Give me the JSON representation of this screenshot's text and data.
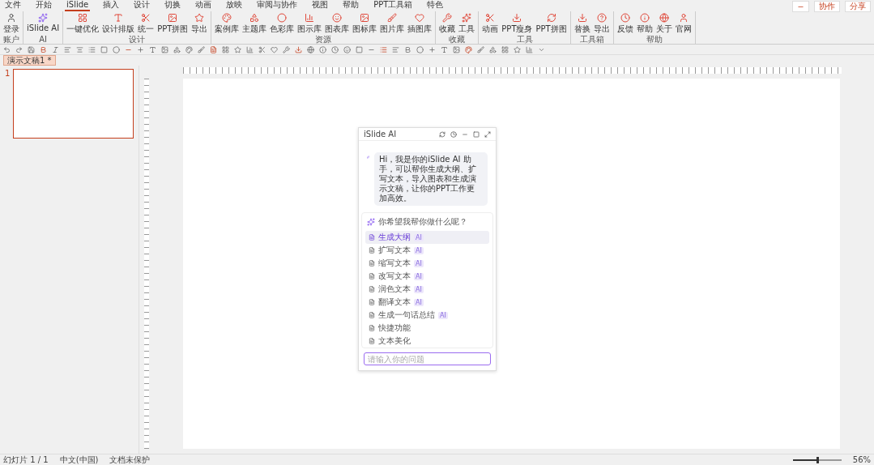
{
  "menu": [
    {
      "label": "文件",
      "selected": false
    },
    {
      "label": "开始",
      "selected": false
    },
    {
      "label": "iSlide",
      "selected": true
    },
    {
      "label": "插入",
      "selected": false
    },
    {
      "label": "设计",
      "selected": false
    },
    {
      "label": "切换",
      "selected": false
    },
    {
      "label": "动画",
      "selected": false
    },
    {
      "label": "放映",
      "selected": false
    },
    {
      "label": "审阅与协作",
      "selected": false
    },
    {
      "label": "视图",
      "selected": false
    },
    {
      "label": "帮助",
      "selected": false
    },
    {
      "label": "PPT工具箱",
      "selected": false
    },
    {
      "label": "特色",
      "selected": false
    }
  ],
  "top_buttons": [
    {
      "label": "协作"
    },
    {
      "label": "分享"
    }
  ],
  "ribbon": [
    {
      "label": "账户",
      "items": [
        {
          "label": "登录"
        }
      ]
    },
    {
      "label": "AI",
      "items": [
        {
          "label": "iSlide AI"
        }
      ]
    },
    {
      "label": "设计",
      "items": [
        {
          "label": "一键优化"
        },
        {
          "label": "设计排版"
        },
        {
          "label": "统一"
        },
        {
          "label": "PPT拼图"
        },
        {
          "label": "导出"
        }
      ]
    },
    {
      "label": "资源",
      "items": [
        {
          "label": "案例库"
        },
        {
          "label": "主题库"
        },
        {
          "label": "色彩库"
        },
        {
          "label": "图示库"
        },
        {
          "label": "图表库"
        },
        {
          "label": "图标库"
        },
        {
          "label": "图片库"
        },
        {
          "label": "插图库"
        }
      ]
    },
    {
      "label": "收藏",
      "items": [
        {
          "label": "收藏"
        },
        {
          "label": "工具"
        }
      ]
    },
    {
      "label": "工具",
      "items": [
        {
          "label": "动画"
        },
        {
          "label": "PPT瘦身"
        },
        {
          "label": "PPT拼图"
        }
      ]
    },
    {
      "label": "工具箱",
      "items": [
        {
          "label": "替换"
        },
        {
          "label": "导出"
        }
      ]
    },
    {
      "label": "帮助",
      "items": [
        {
          "label": "反馈"
        },
        {
          "label": "帮助"
        },
        {
          "label": "关于"
        },
        {
          "label": "官网"
        }
      ]
    }
  ],
  "doc_tab": {
    "label": "演示文稿1 *"
  },
  "slides": [
    {
      "number": "1",
      "selected": true
    }
  ],
  "ai_panel": {
    "title": "iSlide AI",
    "greeting": "Hi，我是你的iSlide AI 助手，可以帮你生成大纲、扩写文本，导入图表和生成演示文稿，让你的PPT工作更加高效。",
    "question": "你希望我帮你做什么呢？",
    "items": [
      {
        "label": "生成大纲",
        "tag": "AI",
        "selected": true
      },
      {
        "label": "扩写文本",
        "tag": "AI",
        "selected": false
      },
      {
        "label": "缩写文本",
        "tag": "AI",
        "selected": false
      },
      {
        "label": "改写文本",
        "tag": "AI",
        "selected": false
      },
      {
        "label": "润色文本",
        "tag": "AI",
        "selected": false
      },
      {
        "label": "翻译文本",
        "tag": "AI",
        "selected": false
      },
      {
        "label": "生成一句话总结",
        "tag": "AI",
        "selected": false
      },
      {
        "label": "快捷功能",
        "selected": false
      },
      {
        "label": "文本美化",
        "selected": false
      }
    ],
    "input": {
      "placeholder": "请输入你的问题"
    }
  },
  "status_bar": {
    "left": [
      "幻灯片 1 / 1",
      "中文(中国)",
      "文档未保护"
    ],
    "zoom": {
      "level": 0.5,
      "label": "56%"
    }
  }
}
